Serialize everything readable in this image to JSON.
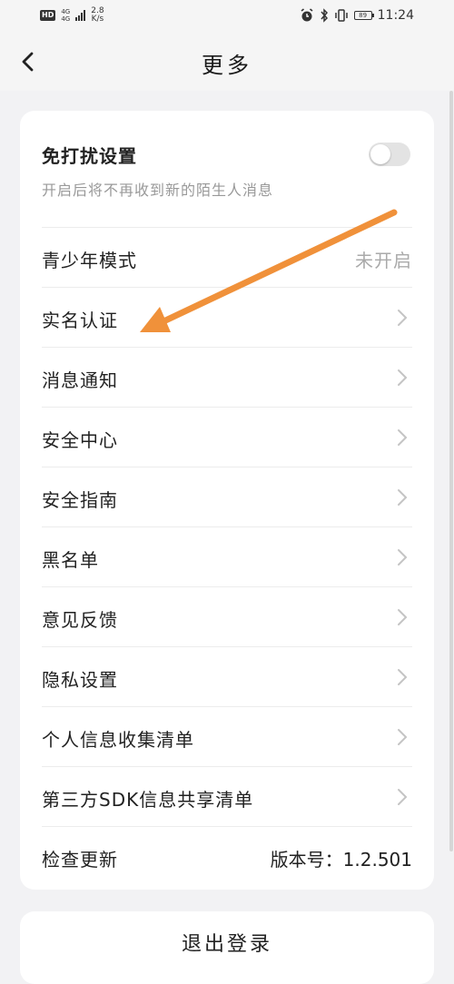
{
  "status_bar": {
    "hd": "HD",
    "net_top": "4G",
    "net_bottom": "4G",
    "speed_value": "2.8",
    "speed_unit": "K/s",
    "battery": "89",
    "time": "11:24"
  },
  "header": {
    "title": "更多"
  },
  "do_not_disturb": {
    "title": "免打扰设置",
    "subtitle": "开启后将不再收到新的陌生人消息",
    "enabled": false
  },
  "settings": [
    {
      "label": "青少年模式",
      "value": "未开启"
    },
    {
      "label": "实名认证"
    },
    {
      "label": "消息通知"
    },
    {
      "label": "安全中心"
    },
    {
      "label": "安全指南"
    },
    {
      "label": "黑名单"
    },
    {
      "label": "意见反馈"
    },
    {
      "label": "隐私设置"
    },
    {
      "label": "个人信息收集清单"
    },
    {
      "label": "第三方SDK信息共享清单"
    },
    {
      "label": "检查更新",
      "value": "版本号：1.2.501"
    }
  ],
  "logout": {
    "label": "退出登录"
  },
  "colors": {
    "background": "#f2f2f4",
    "card": "#ffffff",
    "annotation_arrow": "#f0913a"
  }
}
